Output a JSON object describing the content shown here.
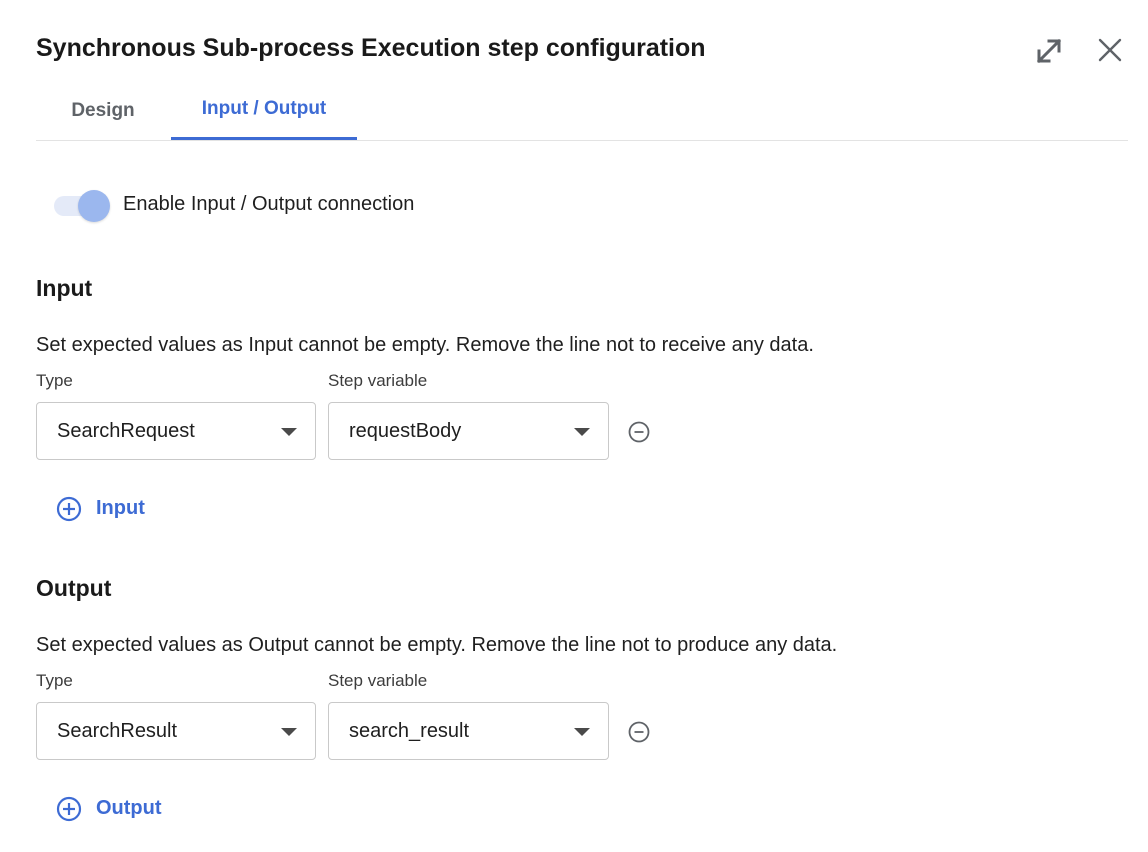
{
  "header": {
    "title": "Synchronous Sub-process Execution step configuration",
    "expand_icon": "expand-icon",
    "close_icon": "close-icon"
  },
  "tabs": [
    {
      "label": "Design",
      "active": false
    },
    {
      "label": "Input / Output",
      "active": true
    }
  ],
  "toggle": {
    "label": "Enable Input / Output connection",
    "enabled": true
  },
  "input": {
    "heading": "Input",
    "description": "Set expected values as Input cannot be empty. Remove the line not to receive any data.",
    "type_label": "Type",
    "variable_label": "Step variable",
    "rows": [
      {
        "type": "SearchRequest",
        "variable": "requestBody"
      }
    ],
    "add_label": "Input"
  },
  "output": {
    "heading": "Output",
    "description": "Set expected values as Output cannot be empty. Remove the line not to produce any data.",
    "type_label": "Type",
    "variable_label": "Step variable",
    "rows": [
      {
        "type": "SearchResult",
        "variable": "search_result"
      }
    ],
    "add_label": "Output"
  },
  "colors": {
    "accent": "#3d6bd4",
    "toggle_track": "#e4eaf8",
    "toggle_knob": "#9bb7ee"
  }
}
